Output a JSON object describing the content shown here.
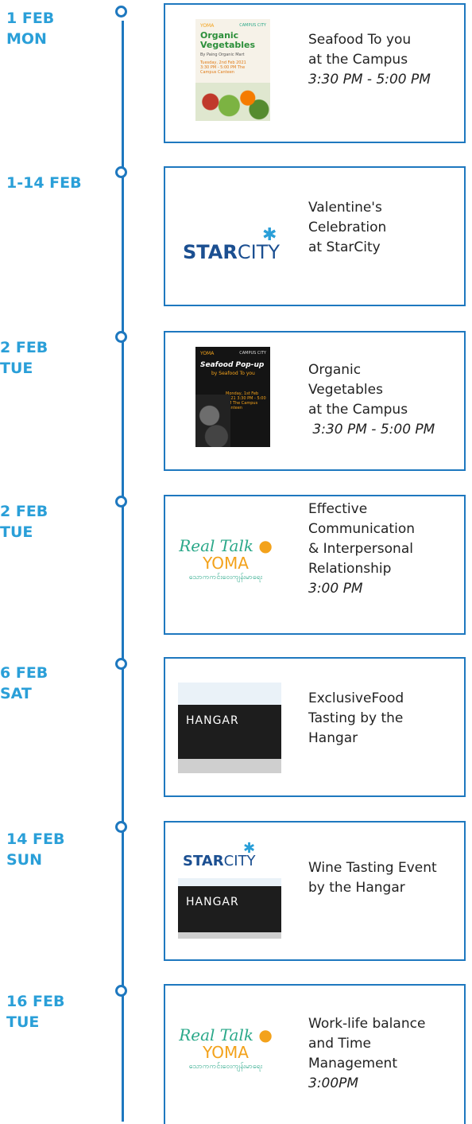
{
  "accent_color": "#1e78bf",
  "date_color": "#2a9fd8",
  "events": [
    {
      "date_line1": "1 FEB",
      "date_line2": "MON",
      "title_lines": [
        "Seafood To you",
        "at the Campus"
      ],
      "time": "3:30 PM - 5:00 PM",
      "thumbnail": {
        "type": "poster",
        "brand": "YOMA",
        "partner": "CAMPUS CITY",
        "headline": "Organic Vegetables",
        "byline": "By Paing Organic Mart",
        "details": "Tuesday, 2nd Feb 2021 3:30 PM - 5:00 PM The Campus Canteen"
      }
    },
    {
      "date_line1": "1-14 FEB",
      "date_line2": "",
      "title_lines": [
        "Valentine's",
        "Celebration",
        "at StarCity"
      ],
      "time": "",
      "thumbnail": {
        "type": "starcity",
        "word1": "STAR",
        "word2": "CITY"
      }
    },
    {
      "date_line1": "2 FEB",
      "date_line2": "TUE",
      "title_lines": [
        "Organic",
        "Vegetables",
        "at the Campus"
      ],
      "time": " 3:30 PM - 5:00 PM",
      "thumbnail": {
        "type": "poster",
        "brand": "YOMA",
        "partner": "CAMPUS CITY",
        "headline": "Seafood Pop-up",
        "byline": "by Seafood To you",
        "details": "Monday, 1st Feb 2021 3:30 PM - 5:00 PM The Campus Canteen"
      }
    },
    {
      "date_line1": "2 FEB",
      "date_line2": "TUE",
      "title_lines": [
        "Effective",
        "Communication",
        "& Interpersonal",
        "Relationship"
      ],
      "time": "3:00 PM",
      "thumbnail": {
        "type": "realtalk",
        "line1": "Real Talk",
        "line2": "YOMA",
        "line3": "သောကကင်းဝေးကျန်းမာရေး"
      }
    },
    {
      "date_line1": "6 FEB",
      "date_line2": "SAT",
      "title_lines": [
        "ExclusiveFood",
        "Tasting by the",
        "Hangar"
      ],
      "time": "",
      "thumbnail": {
        "type": "hangar",
        "text": "HANGAR"
      }
    },
    {
      "date_line1": "14 FEB",
      "date_line2": "SUN",
      "title_lines": [
        "Wine Tasting Event",
        "by the Hangar"
      ],
      "time": "",
      "thumbnail": {
        "type": "starcity+hangar",
        "word1": "STAR",
        "word2": "CITY",
        "text": "HANGAR"
      }
    },
    {
      "date_line1": "16 FEB",
      "date_line2": "TUE",
      "title_lines": [
        "Work-life balance",
        "and Time",
        "Management"
      ],
      "time": "3:00PM",
      "thumbnail": {
        "type": "realtalk",
        "line1": "Real Talk",
        "line2": "YOMA",
        "line3": "သောကကင်းဝေးကျန်းမာရေး"
      }
    }
  ]
}
